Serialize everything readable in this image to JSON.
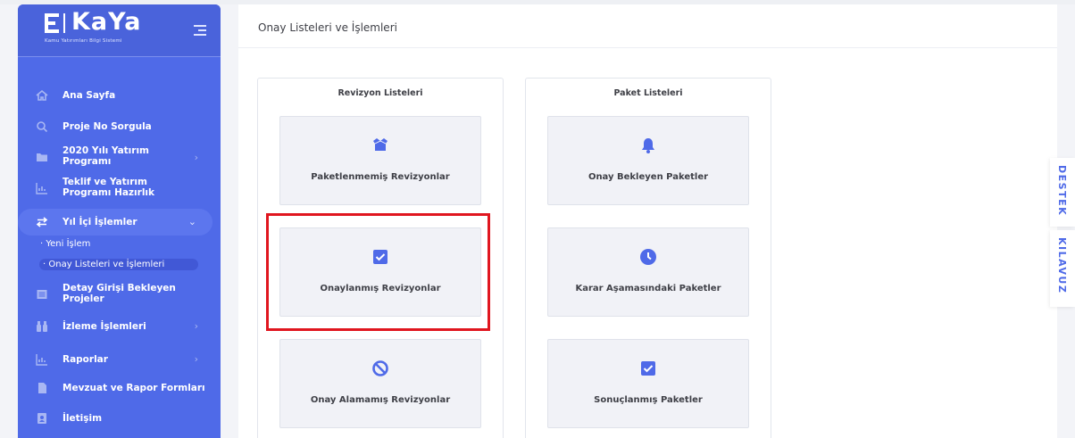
{
  "brand": {
    "name": "KaYa",
    "subtitle": "Kamu Yatırımları Bilgi Sistemi"
  },
  "sidebar": {
    "items": [
      {
        "icon": "home-icon",
        "label": "Ana Sayfa"
      },
      {
        "icon": "search-icon",
        "label": "Proje No Sorgula"
      },
      {
        "icon": "folder-icon",
        "label": "2020 Yılı Yatırım Programı"
      },
      {
        "icon": "chart-icon",
        "label": "Teklif ve Yatırım Programı Hazırlık"
      },
      {
        "icon": "exchange-icon",
        "label": "Yıl İçi İşlemler"
      },
      {
        "icon": "table-icon",
        "label": "Detay Girişi Bekleyen Projeler"
      },
      {
        "icon": "binoculars-icon",
        "label": "İzleme İşlemleri"
      },
      {
        "icon": "chart-icon",
        "label": "Raporlar"
      },
      {
        "icon": "document-icon",
        "label": "Mevzuat ve Rapor Formları"
      },
      {
        "icon": "contact-icon",
        "label": "İletişim"
      }
    ],
    "sub_items": [
      {
        "label": "Yeni İşlem"
      },
      {
        "label": "Onay Listeleri ve İşlemleri"
      }
    ]
  },
  "header": {
    "title": "Onay Listeleri ve İşlemleri"
  },
  "panels": [
    {
      "title": "Revizyon Listeleri",
      "cards": [
        {
          "icon": "box-icon",
          "label": "Paketlenmemiş Revizyonlar"
        },
        {
          "icon": "checkbox-icon",
          "label": "Onaylanmış Revizyonlar"
        },
        {
          "icon": "ban-icon",
          "label": "Onay Alamamış Revizyonlar"
        }
      ]
    },
    {
      "title": "Paket Listeleri",
      "cards": [
        {
          "icon": "bell-icon",
          "label": "Onay Bekleyen Paketler"
        },
        {
          "icon": "clock-icon",
          "label": "Karar Aşamasındaki Paketler"
        },
        {
          "icon": "checkbox-icon",
          "label": "Sonuçlanmış Paketler"
        }
      ]
    }
  ],
  "side_tabs": {
    "support": "DESTEK",
    "guide": "KILAVUZ"
  },
  "colors": {
    "sidebar": "#4f6ae8",
    "accent": "#4f6ae8",
    "highlight": "#e0161f"
  }
}
